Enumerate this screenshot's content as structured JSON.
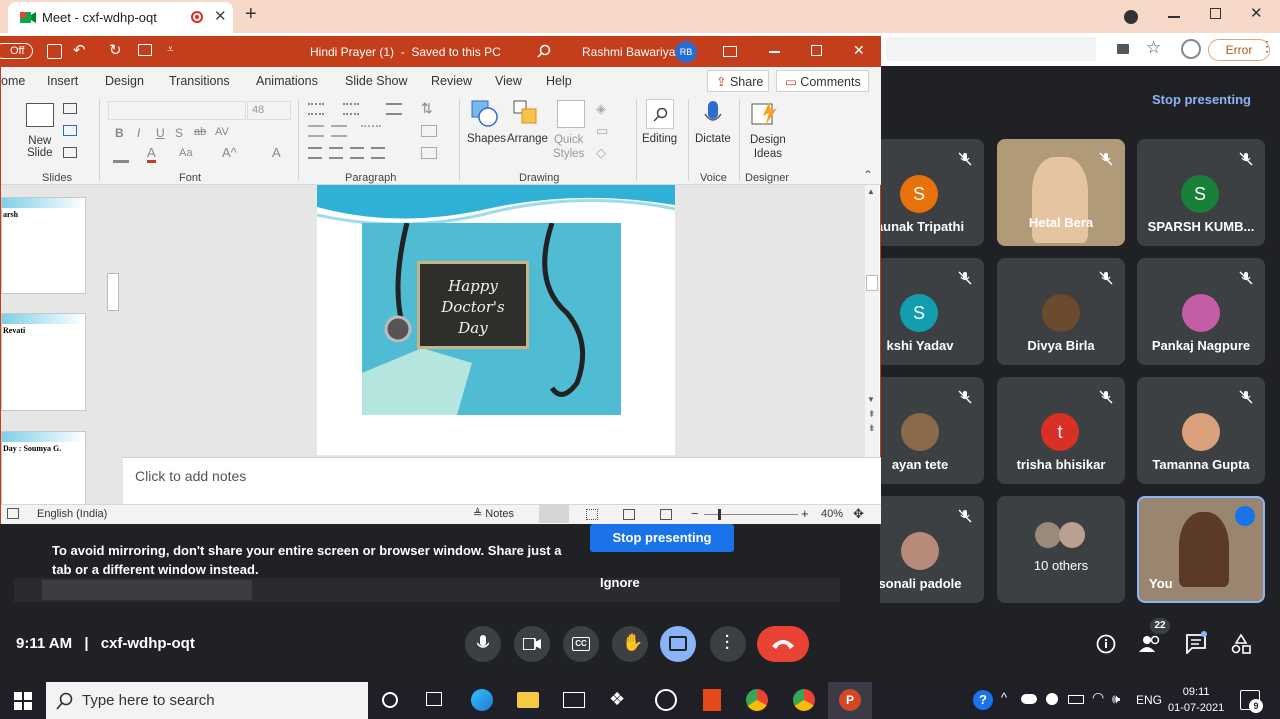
{
  "browser": {
    "tab_title": "Meet - cxf-wdhp-oqt",
    "error_label": "Error"
  },
  "meet": {
    "stop_presenting_top": "Stop presenting",
    "meeting_code": "cxf-wdhp-oqt",
    "time": "9:11 AM",
    "separator": "|",
    "participant_count": "22",
    "participants": [
      {
        "name": "aunak Tripathi",
        "initial": "S",
        "color": "#e8710a"
      },
      {
        "name": "Hetal Bera",
        "initial": "",
        "color": "#c9b48a"
      },
      {
        "name": "SPARSH KUMB...",
        "initial": "S",
        "color": "#188038"
      },
      {
        "name": "kshi Yadav",
        "initial": "S",
        "color": "#129eaf"
      },
      {
        "name": "Divya Birla",
        "initial": "",
        "color": "#6b4a2e"
      },
      {
        "name": "Pankaj Nagpure",
        "initial": "",
        "color": "#c25da6"
      },
      {
        "name": "ayan tete",
        "initial": "",
        "color": "#8a6a4a"
      },
      {
        "name": "trisha bhisikar",
        "initial": "t",
        "color": "#d93025"
      },
      {
        "name": "Tamanna Gupta",
        "initial": "",
        "color": "#d9a07a"
      },
      {
        "name": "sonali padole",
        "initial": "",
        "color": "#b88a7a"
      },
      {
        "name": "10 others",
        "initial": "",
        "color": "#5f6368"
      },
      {
        "name": "You",
        "initial": "",
        "color": "#9a8670"
      }
    ],
    "warning": "To avoid mirroring, don't share your entire screen or browser window. Share just a tab or a different window instead.",
    "stop_presenting_button": "Stop presenting",
    "ignore": "Ignore"
  },
  "ppt": {
    "autosave": "Off",
    "title": "Hindi Prayer (1)  -  Saved to this PC",
    "user": "Rashmi Bawariya",
    "user_initials": "RB",
    "tabs": [
      "ome",
      "Insert",
      "Design",
      "Transitions",
      "Animations",
      "Slide Show",
      "Review",
      "View",
      "Help"
    ],
    "share": "Share",
    "comments": "Comments",
    "groups": {
      "slides": "Slides",
      "font": "Font",
      "paragraph": "Paragraph",
      "drawing": "Drawing",
      "voice": "Voice",
      "designer": "Designer"
    },
    "buttons": {
      "new_slide_1": "New",
      "new_slide_2": "Slide",
      "font_size": "48",
      "shapes": "Shapes",
      "arrange": "Arrange",
      "quick_styles_1": "Quick",
      "quick_styles_2": "Styles",
      "editing": "Editing",
      "dictate": "Dictate",
      "design_ideas_1": "Design",
      "design_ideas_2": "Ideas"
    },
    "thumbnails": [
      "arsh",
      "Revati",
      "Day : Soumya G."
    ],
    "slide_text": [
      "Happy",
      "Doctor's",
      "Day"
    ],
    "notes_placeholder": "Click to add notes",
    "status_language": "English (India)",
    "notes_button": "Notes",
    "zoom": "40%"
  },
  "taskbar": {
    "search_placeholder": "Type here to search",
    "language": "ENG",
    "clock_time": "09:11",
    "clock_date": "01-07-2021",
    "notifications": "9"
  }
}
